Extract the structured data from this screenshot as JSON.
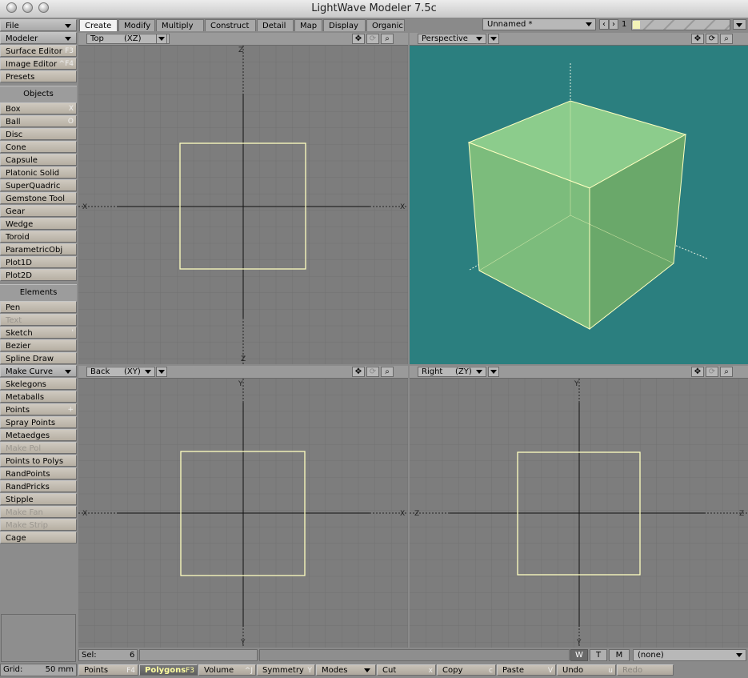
{
  "window": {
    "title": "LightWave Modeler 7.5c"
  },
  "sidebar": {
    "top": [
      {
        "label": "File",
        "dropdown": true
      },
      {
        "label": "Modeler",
        "dropdown": true
      },
      {
        "label": "Surface Editor",
        "key": "F3"
      },
      {
        "label": "Image Editor",
        "key": "^F4"
      },
      {
        "label": "Presets",
        "key": ""
      }
    ],
    "objects_header": "Objects",
    "objects": [
      {
        "label": "Box",
        "key": "X"
      },
      {
        "label": "Ball",
        "key": "O"
      },
      {
        "label": "Disc",
        "key": ""
      },
      {
        "label": "Cone",
        "key": ""
      },
      {
        "label": "Capsule",
        "key": ""
      },
      {
        "label": "Platonic Solid",
        "key": ""
      },
      {
        "label": "SuperQuadric",
        "key": ""
      },
      {
        "label": "Gemstone Tool",
        "key": ""
      },
      {
        "label": "Gear",
        "key": ""
      },
      {
        "label": "Wedge",
        "key": ""
      },
      {
        "label": "Toroid",
        "key": ""
      },
      {
        "label": "ParametricObj",
        "key": ""
      },
      {
        "label": "Plot1D",
        "key": ""
      },
      {
        "label": "Plot2D",
        "key": ""
      }
    ],
    "elements_header": "Elements",
    "elements": [
      {
        "label": "Pen",
        "key": ""
      },
      {
        "label": "Text",
        "key": "",
        "disabled": true
      },
      {
        "label": "Sketch",
        "key": "'"
      },
      {
        "label": "Bezier",
        "key": ""
      },
      {
        "label": "Spline Draw",
        "key": ""
      },
      {
        "label": "Make Curve",
        "key": "",
        "dropdown": true
      },
      {
        "label": "Skelegons",
        "key": ""
      },
      {
        "label": "Metaballs",
        "key": ""
      },
      {
        "label": "Points",
        "key": "+"
      },
      {
        "label": "Spray Points",
        "key": ""
      },
      {
        "label": "Metaedges",
        "key": ""
      },
      {
        "label": "Make Pol",
        "key": "",
        "disabled": true
      },
      {
        "label": "Points to Polys",
        "key": ""
      },
      {
        "label": "RandPoints",
        "key": ""
      },
      {
        "label": "RandPricks",
        "key": ""
      },
      {
        "label": "Stipple",
        "key": ""
      },
      {
        "label": "Make Fan",
        "key": "",
        "disabled": true
      },
      {
        "label": "Make Strip",
        "key": "",
        "disabled": true
      },
      {
        "label": "Cage",
        "key": ""
      }
    ],
    "grid_label": "Grid:",
    "grid_value": "50 mm"
  },
  "tabs": [
    "Create",
    "Modify",
    "Multiply",
    "Construct",
    "Detail",
    "Map",
    "Display",
    "Organic"
  ],
  "selected_tab": "Create",
  "object_selector": {
    "value": "Unnamed *",
    "layer": "1"
  },
  "viewports": {
    "top": {
      "name": "Top",
      "axes": "(XZ)",
      "up": "Z",
      "down": "Z",
      "left": "X",
      "right": "X"
    },
    "perspective": {
      "name": "Perspective"
    },
    "back": {
      "name": "Back",
      "axes": "(XY)",
      "up": "Y",
      "down": "Y",
      "left": "X",
      "right": "X"
    },
    "right": {
      "name": "Right",
      "axes": "(ZY)",
      "up": "Y",
      "down": "Y",
      "left": "Z",
      "right": "Z"
    }
  },
  "status": {
    "sel_label": "Sel:",
    "sel_value": "6",
    "w": "W",
    "t": "T",
    "m": "M",
    "surface": "(none)"
  },
  "bottom": [
    {
      "label": "Points",
      "key": "F4"
    },
    {
      "label": "Polygons",
      "key": "F3",
      "selected": true
    },
    {
      "label": "Volume",
      "key": "^J"
    },
    {
      "label": "Symmetry",
      "key": "Y"
    },
    {
      "label": "Modes",
      "key": "",
      "dropdown": true
    },
    {
      "label": "Cut",
      "key": "x"
    },
    {
      "label": "Copy",
      "key": "c"
    },
    {
      "label": "Paste",
      "key": "V"
    },
    {
      "label": "Undo",
      "key": "u"
    },
    {
      "label": "Redo",
      "key": "",
      "disabled": true
    }
  ],
  "colors": {
    "perspective_bg": "#2b7f7f",
    "cube_fill": "#8cd08c",
    "wire": "#ffffc0",
    "viewport_bg": "#7d7d7d"
  }
}
